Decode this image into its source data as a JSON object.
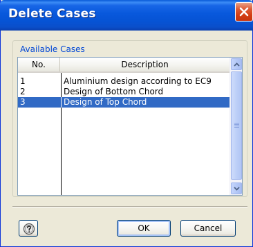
{
  "window": {
    "title": "Delete Cases",
    "close_icon": "close-icon"
  },
  "group": {
    "label": "Available Cases"
  },
  "table": {
    "columns": [
      "No.",
      "Description"
    ],
    "rows": [
      {
        "no": "1",
        "description": "Aluminium design according to EC9"
      },
      {
        "no": "2",
        "description": "Design of Bottom Chord"
      },
      {
        "no": "3",
        "description": "Design of Top Chord"
      }
    ],
    "selected_index": 2
  },
  "buttons": {
    "help_icon": "help-icon",
    "ok_label": "OK",
    "cancel_label": "Cancel"
  },
  "colors": {
    "titlebar": "#0858dc",
    "close": "#d23c13",
    "selection": "#316ac5",
    "group_label": "#0046d5"
  }
}
